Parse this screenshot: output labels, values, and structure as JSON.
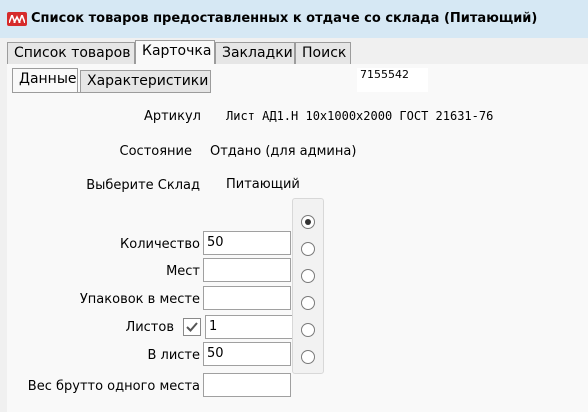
{
  "window": {
    "title": "Список товаров предоставленных к отдаче со склада (Питающий)"
  },
  "main_tabs": [
    {
      "label": "Список товаров",
      "active": false
    },
    {
      "label": "Карточка",
      "active": true
    },
    {
      "label": "Закладки",
      "active": false
    },
    {
      "label": "Поиск",
      "active": false
    }
  ],
  "sub_tabs": [
    {
      "label": "Данные",
      "active": true
    },
    {
      "label": "Характеристики",
      "active": false
    }
  ],
  "record_id": "7155542",
  "form": {
    "article": {
      "label": "Артикул",
      "value": "Лист АД1.Н 10х1000х2000 ГОСТ 21631-76"
    },
    "state": {
      "label": "Состояние",
      "value": "Отдано (для админа)"
    },
    "warehouse": {
      "label": "Выберите Склад",
      "value": "Питающий"
    },
    "quantity": {
      "label": "Количество",
      "value": "50"
    },
    "places": {
      "label": "Мест",
      "value": ""
    },
    "packs_per_place": {
      "label": "Упаковок в месте",
      "value": ""
    },
    "sheets": {
      "label": "Листов",
      "value": "1",
      "checked": true
    },
    "per_sheet": {
      "label": "В листе",
      "value": "50"
    },
    "gross_weight": {
      "label": "Вес брутто одного места",
      "value": ""
    }
  },
  "unit_choice": {
    "selected_index": 0,
    "count": 6
  }
}
